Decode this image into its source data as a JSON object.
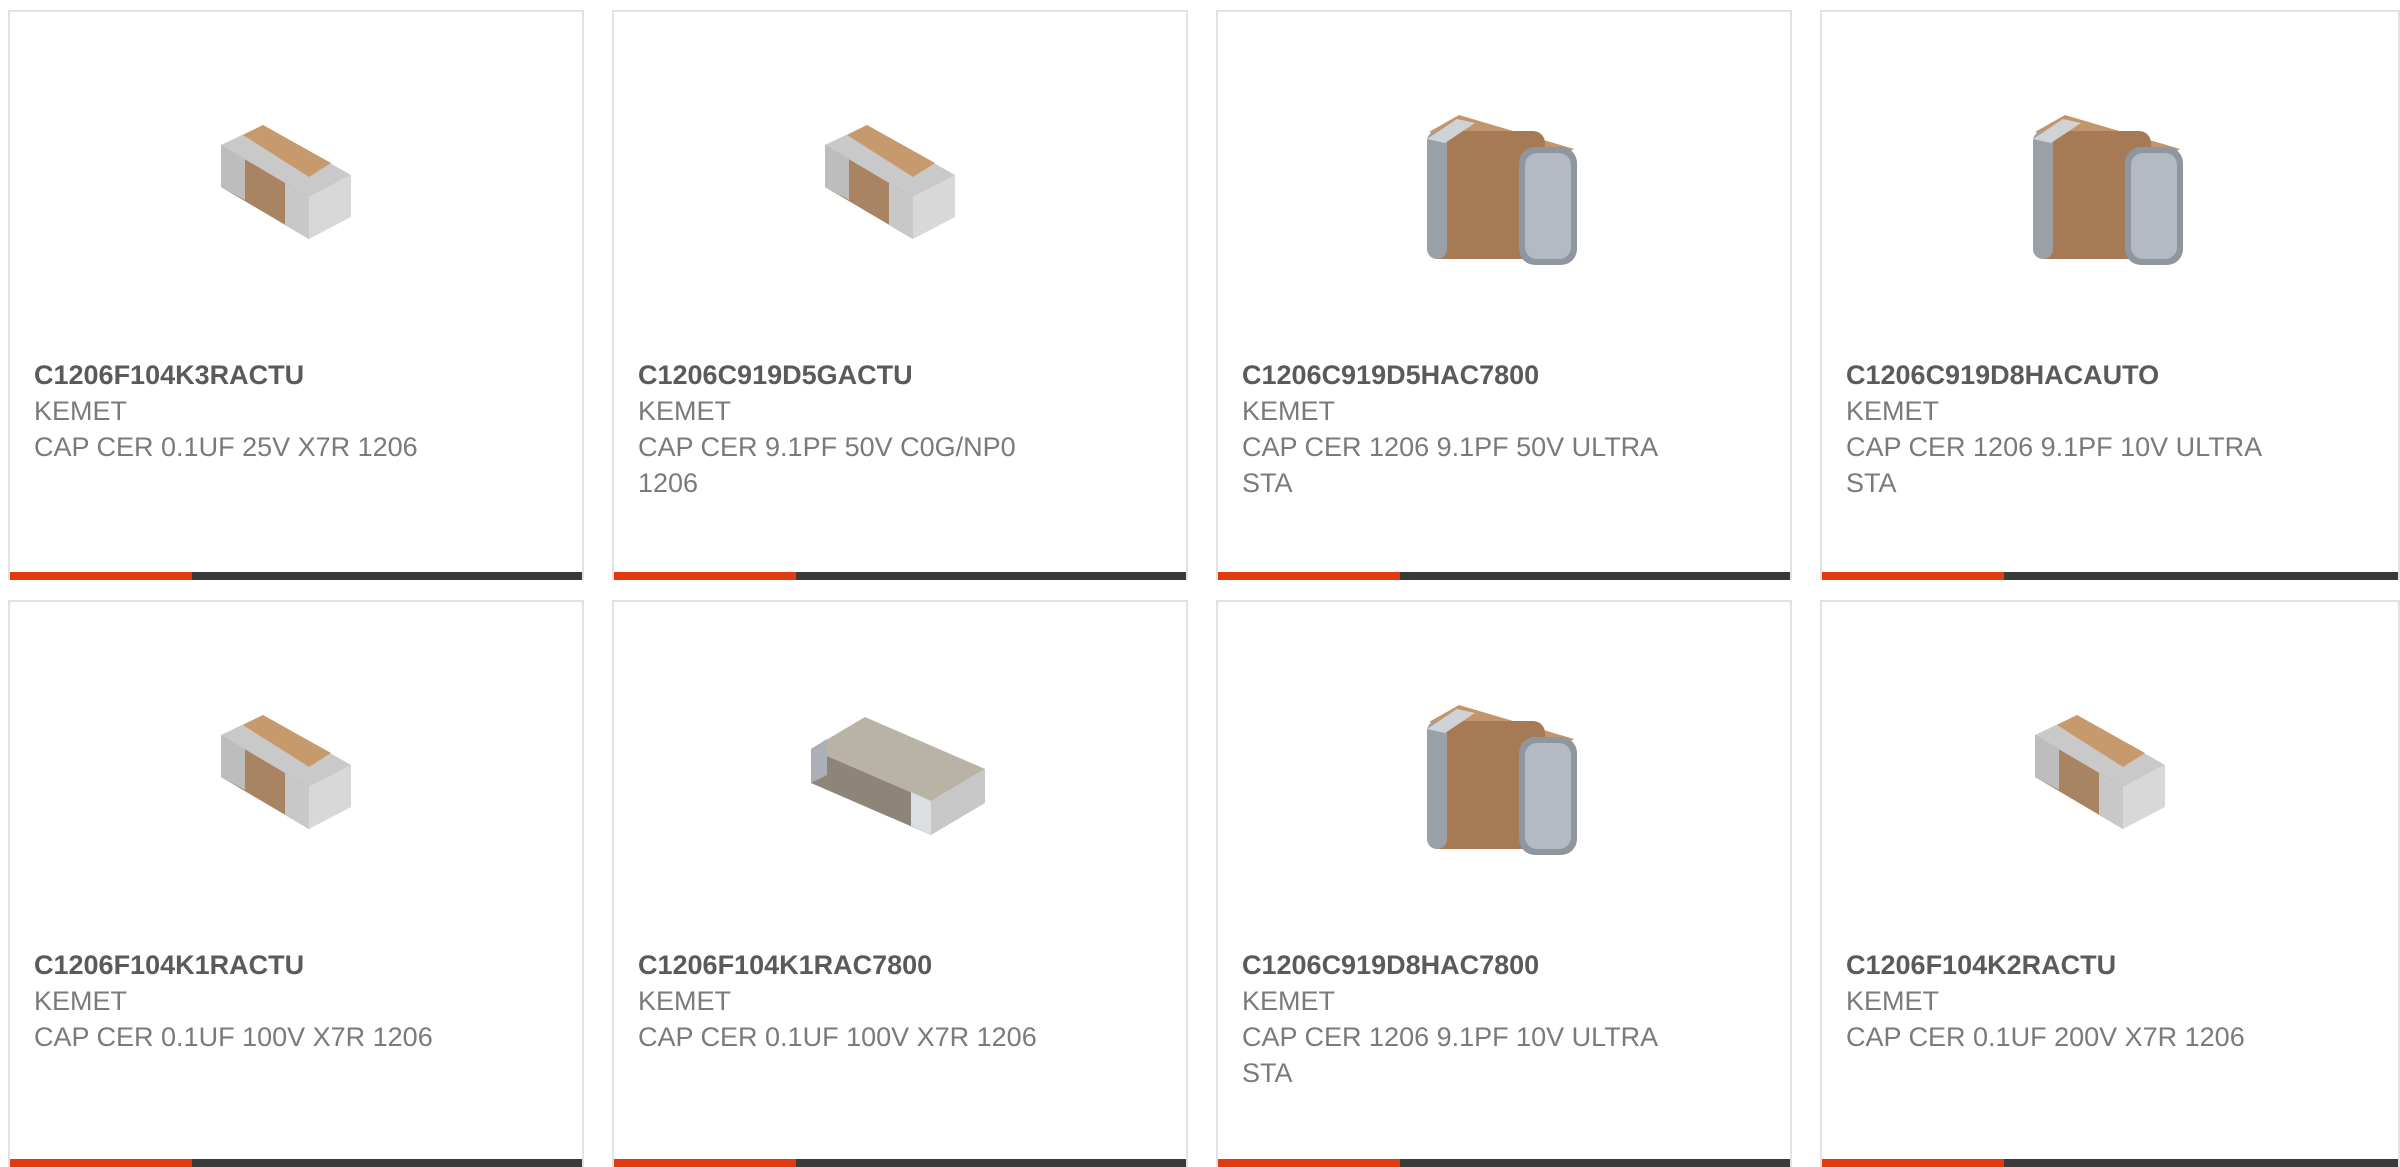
{
  "theme": {
    "accent": "#e03a10",
    "bar": "#3a3a3a"
  },
  "cards": [
    {
      "part": "C1206F104K3RACTU",
      "mfr": "KEMET",
      "desc": "CAP CER 0.1UF 25V X7R 1206",
      "image": "small-chip-capacitor"
    },
    {
      "part": "C1206C919D5GACTU",
      "mfr": "KEMET",
      "desc": "CAP CER 9.1PF 50V C0G/NP0 1206",
      "image": "small-chip-capacitor"
    },
    {
      "part": "C1206C919D5HAC7800",
      "mfr": "KEMET",
      "desc": "CAP CER 1206 9.1PF 50V ULTRA STA",
      "image": "large-chip-capacitor"
    },
    {
      "part": "C1206C919D8HACAUTO",
      "mfr": "KEMET",
      "desc": "CAP CER 1206 9.1PF 10V ULTRA STA",
      "image": "large-chip-capacitor"
    },
    {
      "part": "C1206F104K1RACTU",
      "mfr": "KEMET",
      "desc": "CAP CER 0.1UF 100V X7R 1206",
      "image": "small-chip-capacitor"
    },
    {
      "part": "C1206F104K1RAC7800",
      "mfr": "KEMET",
      "desc": "CAP CER 0.1UF 100V X7R 1206",
      "image": "flat-chip-capacitor"
    },
    {
      "part": "C1206C919D8HAC7800",
      "mfr": "KEMET",
      "desc": "CAP CER 1206 9.1PF 10V ULTRA STA",
      "image": "large-chip-capacitor"
    },
    {
      "part": "C1206F104K2RACTU",
      "mfr": "KEMET",
      "desc": "CAP CER 0.1UF 200V X7R 1206",
      "image": "small-chip-capacitor"
    }
  ]
}
